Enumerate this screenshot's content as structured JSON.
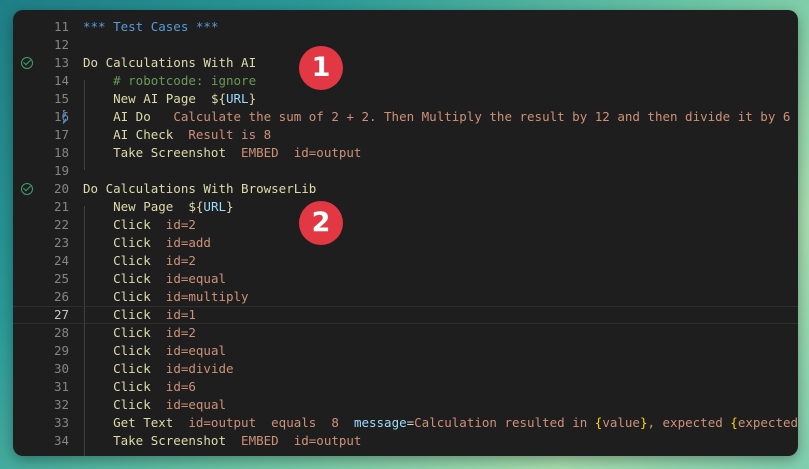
{
  "lines": [
    {
      "n": "11",
      "parts": [
        {
          "t": "*** Test Cases ***",
          "c": "c-header"
        }
      ]
    },
    {
      "n": "12",
      "parts": []
    },
    {
      "n": "13",
      "check": true,
      "parts": [
        {
          "t": "Do Calculations With AI",
          "c": "c-test"
        }
      ]
    },
    {
      "n": "14",
      "parts": [
        {
          "t": "    # robotcode: ignore",
          "c": "c-comment"
        }
      ]
    },
    {
      "n": "15",
      "parts": [
        {
          "t": "    New AI Page  ",
          "c": "c-kw"
        },
        {
          "t": "${",
          "c": "c-var"
        },
        {
          "t": "URL",
          "c": "c-varname"
        },
        {
          "t": "}",
          "c": "c-var"
        }
      ]
    },
    {
      "n": "16",
      "dirty": true,
      "parts": [
        {
          "t": "    AI Do   ",
          "c": "c-kw"
        },
        {
          "t": "Calculate the sum of 2 + 2. Then Multiply the result by 12 and then divide it by 6",
          "c": "c-arg"
        }
      ]
    },
    {
      "n": "17",
      "parts": [
        {
          "t": "    AI Check  ",
          "c": "c-kw"
        },
        {
          "t": "Result is 8",
          "c": "c-arg"
        }
      ]
    },
    {
      "n": "18",
      "parts": [
        {
          "t": "    Take Screenshot  ",
          "c": "c-kw"
        },
        {
          "t": "EMBED  id=output",
          "c": "c-arg"
        }
      ]
    },
    {
      "n": "19",
      "parts": []
    },
    {
      "n": "20",
      "check": true,
      "parts": [
        {
          "t": "Do Calculations With BrowserLib",
          "c": "c-test"
        }
      ]
    },
    {
      "n": "21",
      "parts": [
        {
          "t": "    New Page  ",
          "c": "c-kw"
        },
        {
          "t": "${",
          "c": "c-var"
        },
        {
          "t": "URL",
          "c": "c-varname"
        },
        {
          "t": "}",
          "c": "c-var"
        }
      ]
    },
    {
      "n": "22",
      "parts": [
        {
          "t": "    Click  ",
          "c": "c-kw"
        },
        {
          "t": "id=2",
          "c": "c-arg"
        }
      ]
    },
    {
      "n": "23",
      "parts": [
        {
          "t": "    Click  ",
          "c": "c-kw"
        },
        {
          "t": "id=add",
          "c": "c-arg"
        }
      ]
    },
    {
      "n": "24",
      "parts": [
        {
          "t": "    Click  ",
          "c": "c-kw"
        },
        {
          "t": "id=2",
          "c": "c-arg"
        }
      ]
    },
    {
      "n": "25",
      "parts": [
        {
          "t": "    Click  ",
          "c": "c-kw"
        },
        {
          "t": "id=equal",
          "c": "c-arg"
        }
      ]
    },
    {
      "n": "26",
      "parts": [
        {
          "t": "    Click  ",
          "c": "c-kw"
        },
        {
          "t": "id=multiply",
          "c": "c-arg"
        }
      ]
    },
    {
      "n": "27",
      "current": true,
      "parts": [
        {
          "t": "    Click  ",
          "c": "c-kw"
        },
        {
          "t": "id=1",
          "c": "c-arg"
        }
      ]
    },
    {
      "n": "28",
      "parts": [
        {
          "t": "    Click  ",
          "c": "c-kw"
        },
        {
          "t": "id=2",
          "c": "c-arg"
        }
      ]
    },
    {
      "n": "29",
      "parts": [
        {
          "t": "    Click  ",
          "c": "c-kw"
        },
        {
          "t": "id=equal",
          "c": "c-arg"
        }
      ]
    },
    {
      "n": "30",
      "parts": [
        {
          "t": "    Click  ",
          "c": "c-kw"
        },
        {
          "t": "id=divide",
          "c": "c-arg"
        }
      ]
    },
    {
      "n": "31",
      "parts": [
        {
          "t": "    Click  ",
          "c": "c-kw"
        },
        {
          "t": "id=6",
          "c": "c-arg"
        }
      ]
    },
    {
      "n": "32",
      "parts": [
        {
          "t": "    Click  ",
          "c": "c-kw"
        },
        {
          "t": "id=equal",
          "c": "c-arg"
        }
      ]
    },
    {
      "n": "33",
      "parts": [
        {
          "t": "    Get Text  ",
          "c": "c-kw"
        },
        {
          "t": "id=output  equals  8  ",
          "c": "c-arg"
        },
        {
          "t": "message",
          "c": "c-named"
        },
        {
          "t": "=",
          "c": "c-eq"
        },
        {
          "t": "Calculation resulted in ",
          "c": "c-arg"
        },
        {
          "t": "{",
          "c": "c-brace"
        },
        {
          "t": "value",
          "c": "c-arg"
        },
        {
          "t": "}",
          "c": "c-brace"
        },
        {
          "t": ", expected ",
          "c": "c-arg"
        },
        {
          "t": "{",
          "c": "c-brace"
        },
        {
          "t": "expected",
          "c": "c-arg"
        },
        {
          "t": "}",
          "c": "c-brace"
        }
      ]
    },
    {
      "n": "34",
      "parts": [
        {
          "t": "    Take Screenshot  ",
          "c": "c-kw"
        },
        {
          "t": "EMBED  id=output",
          "c": "c-arg"
        }
      ]
    }
  ],
  "badges": [
    "1",
    "2"
  ],
  "colors": {
    "keyword": "#dcdcaa",
    "argument": "#ce9178",
    "comment": "#6a9955",
    "header": "#569cd6",
    "badge": "#e23844",
    "check": "#3fa36a"
  }
}
